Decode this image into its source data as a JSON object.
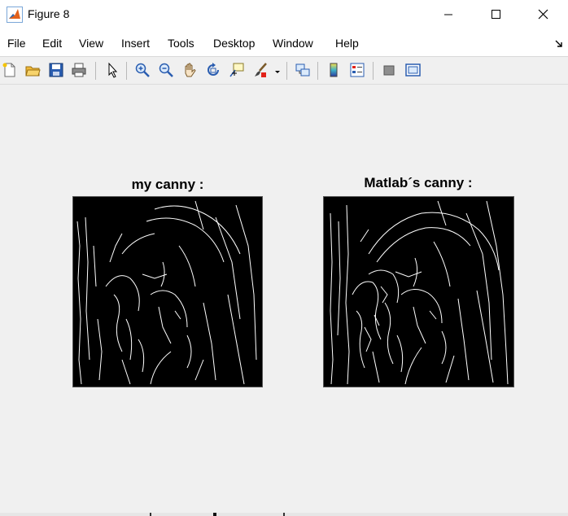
{
  "window": {
    "title": "Figure 8",
    "icon": "matlab-logo-icon",
    "controls": [
      "minimize-icon",
      "maximize-icon",
      "close-icon"
    ]
  },
  "menu": {
    "items": [
      "File",
      "Edit",
      "View",
      "Insert",
      "Tools",
      "Desktop",
      "Window",
      "Help"
    ],
    "dock_icon": "dock-arrow-icon"
  },
  "toolbar": {
    "buttons": [
      "new-figure-icon",
      "open-file-icon",
      "save-icon",
      "print-icon",
      "edit-plot-icon",
      "zoom-in-icon",
      "zoom-out-icon",
      "pan-icon",
      "rotate-3d-icon",
      "data-cursor-icon",
      "brush-icon",
      "brush-dropdown-icon",
      "link-plot-icon",
      "insert-colorbar-icon",
      "insert-legend-icon",
      "hide-plot-tools-icon",
      "show-plot-tools-icon"
    ]
  },
  "figure": {
    "background": "#f0f0f0",
    "axes": [
      {
        "title": "my canny :",
        "content": "binary edge map (white edges on black)"
      },
      {
        "title": "Matlab´s canny :",
        "content": "binary edge map (white edges on black)"
      }
    ]
  }
}
